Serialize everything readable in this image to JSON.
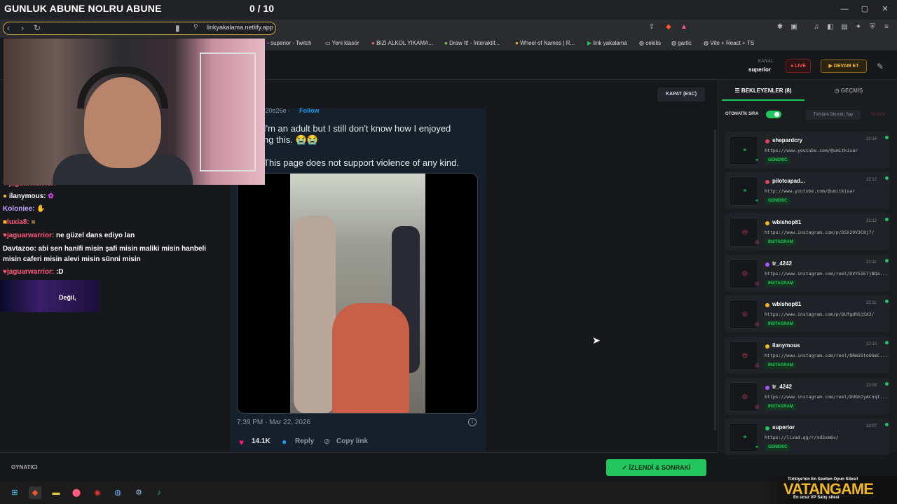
{
  "overlay": {
    "title": "GUNLUK ABUNE NOLRU ABUNE",
    "counter": "0 / 10"
  },
  "browser": {
    "url": "linkyakalama.netlify.app",
    "bookmarks": [
      "superior - Twitch",
      "Yeni klasör",
      "BIZI ALKOL YIKAMA...",
      "Draw It! - İnteraktif...",
      "Wheel of Names | R...",
      "link yakalama",
      "cekilis",
      "gartic",
      "Vite + React + TS"
    ]
  },
  "header": {
    "kanal_label": "KANAL",
    "kanal_name": "superior",
    "live_label": "● LIVE",
    "devam_label": "▶ DEVAM ET"
  },
  "chat": [
    {
      "user": "jaguarwarrior:",
      "msg": "",
      "prefix": "♥"
    },
    {
      "user": "ilanymous:",
      "msg": "",
      "prefix": "● ♥"
    },
    {
      "user": "Koloniee:",
      "msg": "",
      "prefix": ""
    },
    {
      "user": "luxia8:",
      "msg": "",
      "prefix": "■ ♥"
    },
    {
      "user": "jaguarwarrior:",
      "msg": "ne güzel dans ediyo lan",
      "prefix": "♥"
    },
    {
      "user": "Davtazoo:",
      "msg": "abi sen hanifi misin şafi misin maliki misin hanbeli",
      "prefix": ""
    },
    {
      "user": "",
      "msg": "misin caferi misin alevi misin sünni misin",
      "prefix": ""
    },
    {
      "user": "jaguarwarrior:",
      "msg": ":D",
      "prefix": "♥"
    }
  ],
  "chat_banner": "Değil,",
  "main": {
    "kapat_label": "KAPAT (ESC)",
    "tweet": {
      "handle": "N20e26e ·",
      "follow": "Follow",
      "line1": "I'm an adult but I still don't know how I enjoyed",
      "line2": "ng this. 😭😭",
      "line3": "This page does not support violence of any kind.",
      "time": "7:39 PM · Mar 22, 2026",
      "likes": "14.1K",
      "reply": "Reply",
      "copy": "Copy link"
    }
  },
  "panel": {
    "tab_bekleyenler": "BEKLEYENLER (8)",
    "tab_gecmis": "GEÇMİŞ",
    "oto_label": "OTOMATİK SIRA",
    "tumunu_label": "Tümünü Okundu Say",
    "temizle_label": "Temizle",
    "queue": [
      {
        "user": "shepardcry",
        "time": "22:14",
        "url": "https://www.youtube.com/@umitkisar",
        "tag": "GENERIC",
        "type": "generic",
        "dot": "#e4405f"
      },
      {
        "user": "pilotcapad...",
        "time": "22:12",
        "url": "http://www.youtube.com/@umitkisar",
        "tag": "GENERIC",
        "type": "generic",
        "dot": "#e4405f"
      },
      {
        "user": "wbishop81",
        "time": "22:12",
        "url": "https://www.instagram.com/p/DSX29V3C8j7/",
        "tag": "INSTAGRAM",
        "type": "insta",
        "dot": "#f0b722"
      },
      {
        "user": "tr_4242",
        "time": "22:11",
        "url": "https://www.instagram.com/reel/DVY5IE7jBQa...",
        "tag": "INSTAGRAM",
        "type": "insta",
        "dot": "#a855f7"
      },
      {
        "user": "wbishop81",
        "time": "22:11",
        "url": "https://www.instagram.com/p/DUfgdhGjSX2/",
        "tag": "INSTAGRAM",
        "type": "insta",
        "dot": "#f0b722"
      },
      {
        "user": "ilanymous",
        "time": "22:10",
        "url": "https://www.instagram.com/reel/DRm35toOGmC...",
        "tag": "INSTAGRAM",
        "type": "insta",
        "dot": "#f0b722"
      },
      {
        "user": "tr_4242",
        "time": "22:08",
        "url": "https://www.instagram.com/reel/DUGh7yACnqI...",
        "tag": "INSTAGRAM",
        "type": "insta",
        "dot": "#a855f7"
      },
      {
        "user": "superior",
        "time": "22:07",
        "url": "https://livad.gg/r/sd3xm6v/",
        "tag": "GENERIC",
        "type": "generic",
        "dot": "#22c55e"
      }
    ]
  },
  "footer": {
    "label": "OYNATICI",
    "next_label": "✓ İZLENDİ & SONRAKİ"
  },
  "watermark": {
    "top": "Türkiye'nin En Sevilen Oyun Sitesi!",
    "name": "VATANGAME",
    "sub": "En ucuz VP Satış sitesi"
  }
}
